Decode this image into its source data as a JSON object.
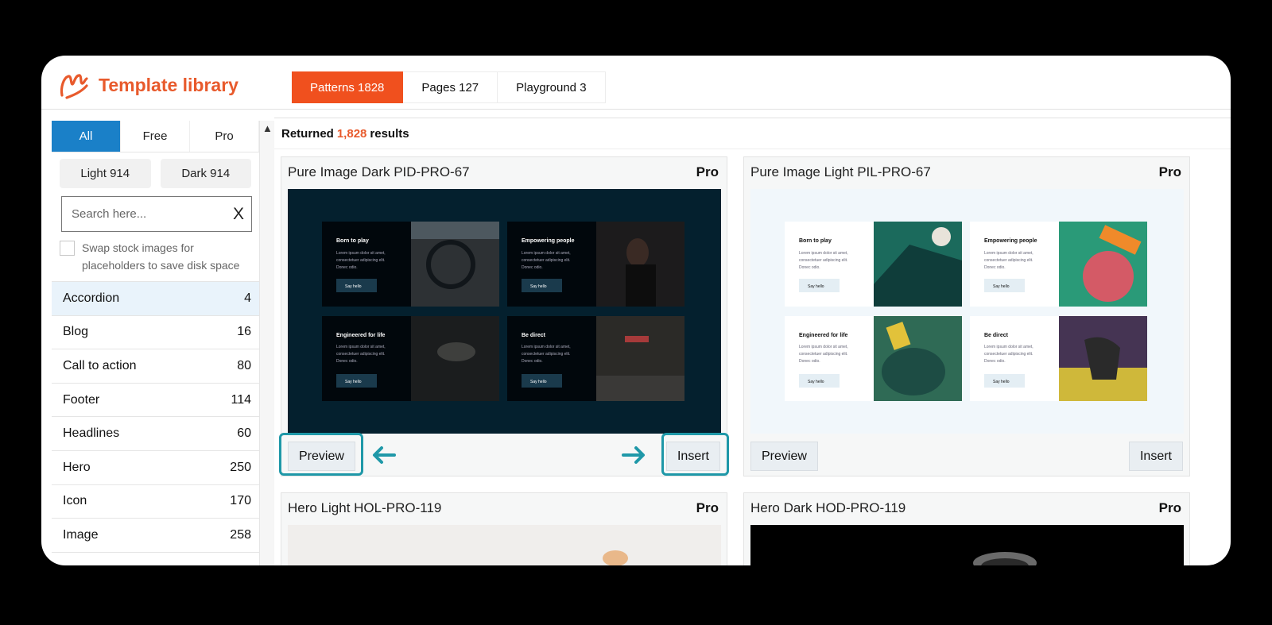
{
  "app": {
    "title": "Template library",
    "brand_color": "#e85a2c",
    "logo_icon": "brand-logo-icon"
  },
  "tabs": [
    {
      "label": "Patterns 1828",
      "active": true
    },
    {
      "label": "Pages 127",
      "active": false
    },
    {
      "label": "Playground 3",
      "active": false
    }
  ],
  "sidebar": {
    "filters": [
      {
        "label": "All",
        "active": true
      },
      {
        "label": "Free",
        "active": false
      },
      {
        "label": "Pro",
        "active": false
      }
    ],
    "themes": [
      "Light 914",
      "Dark 914"
    ],
    "search": {
      "placeholder": "Search here...",
      "clear_label": "X"
    },
    "swap_label": "Swap stock images for placeholders to save disk space",
    "categories": [
      {
        "name": "Accordion",
        "count": "4"
      },
      {
        "name": "Blog",
        "count": "16"
      },
      {
        "name": "Call to action",
        "count": "80"
      },
      {
        "name": "Footer",
        "count": "114"
      },
      {
        "name": "Headlines",
        "count": "60"
      },
      {
        "name": "Hero",
        "count": "250"
      },
      {
        "name": "Icon",
        "count": "170"
      },
      {
        "name": "Image",
        "count": "258"
      }
    ]
  },
  "results": {
    "prefix": "Returned",
    "count": "1,828",
    "suffix": "results"
  },
  "cards": [
    {
      "title": "Pure Image Dark PID-PRO-67",
      "badge": "Pro",
      "preview_label": "Preview",
      "insert_label": "Insert",
      "tiles": [
        {
          "heading": "Born to play",
          "body": "Lorem ipsum dolor sit amet, consectetuer adipiscing elit. Donec odio.",
          "button": "Say hello"
        },
        {
          "heading": "Empowering people",
          "body": "Lorem ipsum dolor sit amet, consectetuer adipiscing elit. Donec odio.",
          "button": "Say hello"
        },
        {
          "heading": "Engineered for life",
          "body": "Lorem ipsum dolor sit amet, consectetuer adipiscing elit. Donec odio.",
          "button": "Say hello"
        },
        {
          "heading": "Be direct",
          "body": "Lorem ipsum dolor sit amet, consectetuer adipiscing elit. Donec odio.",
          "button": "Say hello"
        }
      ]
    },
    {
      "title": "Pure Image Light PIL-PRO-67",
      "badge": "Pro",
      "preview_label": "Preview",
      "insert_label": "Insert",
      "tiles": [
        {
          "heading": "Born to play",
          "body": "Lorem ipsum dolor sit amet, consectetuer adipiscing elit. Donec odio.",
          "button": "Say hello"
        },
        {
          "heading": "Empowering people",
          "body": "Lorem ipsum dolor sit amet, consectetuer adipiscing elit. Donec odio.",
          "button": "Say hello"
        },
        {
          "heading": "Engineered for life",
          "body": "Lorem ipsum dolor sit amet, consectetuer adipiscing elit. Donec odio.",
          "button": "Say hello"
        },
        {
          "heading": "Be direct",
          "body": "Lorem ipsum dolor sit amet, consectetuer adipiscing elit. Donec odio.",
          "button": "Say hello"
        }
      ]
    },
    {
      "title": "Hero Light HOL-PRO-119",
      "badge": "Pro"
    },
    {
      "title": "Hero Dark HOD-PRO-119",
      "badge": "Pro"
    }
  ],
  "colors": {
    "accent": "#f0501e",
    "active_filter": "#1a80c8",
    "highlight": "#1f98a8"
  }
}
